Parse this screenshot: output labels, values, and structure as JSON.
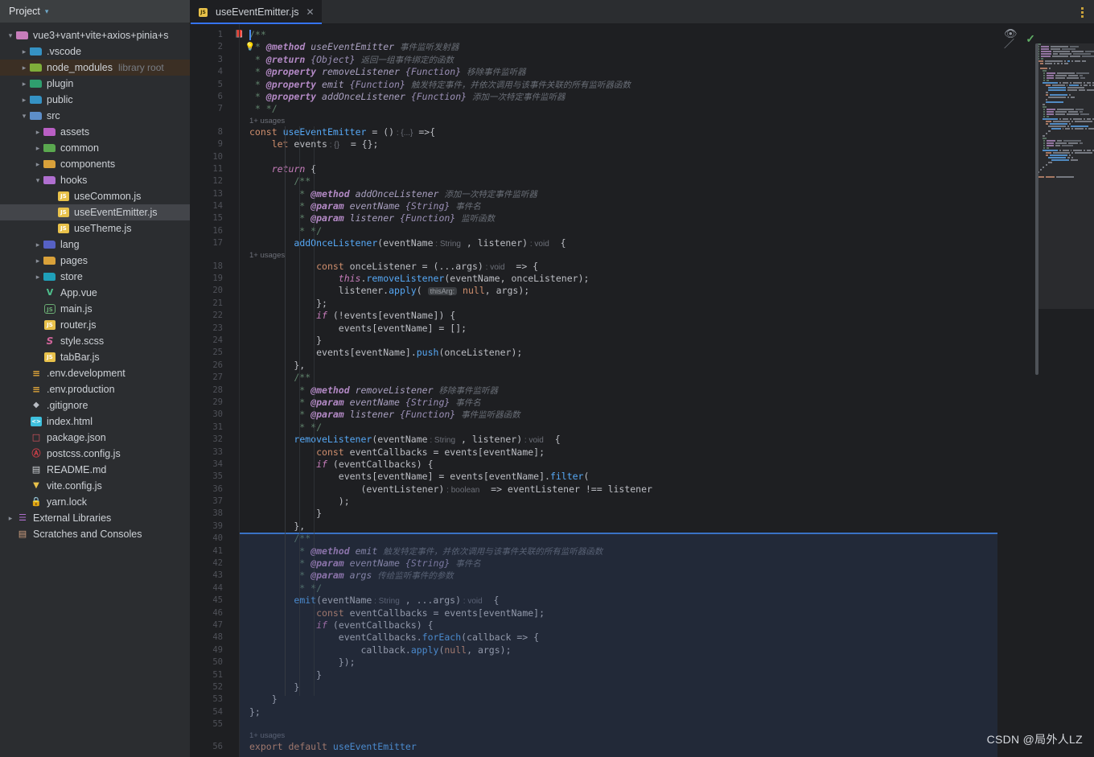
{
  "sidebar": {
    "title": "Project",
    "chevron_icon": "chevron-down-icon",
    "items": [
      {
        "label": "vue3+vant+vite+axios+pinia+s",
        "sub": "",
        "depth": 0,
        "state": "open",
        "icon": "folder-module-icon",
        "color": "#c77dbb",
        "glyph": "",
        "selected": ""
      },
      {
        "label": ".vscode",
        "sub": "",
        "depth": 1,
        "state": "closed",
        "icon": "folder-vscode-icon",
        "color": "#3592c4",
        "glyph": "",
        "selected": ""
      },
      {
        "label": "node_modules",
        "sub": "library root",
        "depth": 1,
        "state": "closed",
        "icon": "folder-node-icon",
        "color": "#7fae3a",
        "glyph": "",
        "selected": "lib"
      },
      {
        "label": "plugin",
        "sub": "",
        "depth": 1,
        "state": "closed",
        "icon": "folder-plugin-icon",
        "color": "#2f9e6e",
        "glyph": "",
        "selected": ""
      },
      {
        "label": "public",
        "sub": "",
        "depth": 1,
        "state": "closed",
        "icon": "folder-public-icon",
        "color": "#3592c4",
        "glyph": "",
        "selected": ""
      },
      {
        "label": "src",
        "sub": "",
        "depth": 1,
        "state": "open",
        "icon": "folder-source-icon",
        "color": "#5d8ec9",
        "glyph": "",
        "selected": ""
      },
      {
        "label": "assets",
        "sub": "",
        "depth": 2,
        "state": "closed",
        "icon": "folder-assets-icon",
        "color": "#b95fc4",
        "glyph": "",
        "selected": ""
      },
      {
        "label": "common",
        "sub": "",
        "depth": 2,
        "state": "closed",
        "icon": "folder-common-icon",
        "color": "#5aa84f",
        "glyph": "",
        "selected": ""
      },
      {
        "label": "components",
        "sub": "",
        "depth": 2,
        "state": "closed",
        "icon": "folder-components-icon",
        "color": "#d9a13a",
        "glyph": "",
        "selected": ""
      },
      {
        "label": "hooks",
        "sub": "",
        "depth": 2,
        "state": "open",
        "icon": "folder-hooks-icon",
        "color": "#b06fd0",
        "glyph": "",
        "selected": ""
      },
      {
        "label": "useCommon.js",
        "sub": "",
        "depth": 3,
        "state": "none",
        "icon": "js-file-icon",
        "color": "#e8c14a",
        "glyph": "JS",
        "selected": ""
      },
      {
        "label": "useEventEmitter.js",
        "sub": "",
        "depth": 3,
        "state": "none",
        "icon": "js-file-icon",
        "color": "#e8c14a",
        "glyph": "JS",
        "selected": "active"
      },
      {
        "label": "useTheme.js",
        "sub": "",
        "depth": 3,
        "state": "none",
        "icon": "js-file-icon",
        "color": "#e8c14a",
        "glyph": "JS",
        "selected": ""
      },
      {
        "label": "lang",
        "sub": "",
        "depth": 2,
        "state": "closed",
        "icon": "folder-lang-icon",
        "color": "#5661c4",
        "glyph": "",
        "selected": ""
      },
      {
        "label": "pages",
        "sub": "",
        "depth": 2,
        "state": "closed",
        "icon": "folder-pages-icon",
        "color": "#d9a13a",
        "glyph": "",
        "selected": ""
      },
      {
        "label": "store",
        "sub": "",
        "depth": 2,
        "state": "closed",
        "icon": "folder-store-icon",
        "color": "#1f9fb8",
        "glyph": "",
        "selected": ""
      },
      {
        "label": "App.vue",
        "sub": "",
        "depth": 2,
        "state": "none",
        "icon": "vue-file-icon",
        "color": "#4fc08d",
        "glyph": "V",
        "selected": ""
      },
      {
        "label": "main.js",
        "sub": "",
        "depth": 2,
        "state": "none",
        "icon": "node-js-file-icon",
        "color": "#6aab73",
        "glyph": "JS",
        "selected": ""
      },
      {
        "label": "router.js",
        "sub": "",
        "depth": 2,
        "state": "none",
        "icon": "js-file-icon",
        "color": "#e8c14a",
        "glyph": "JS",
        "selected": ""
      },
      {
        "label": "style.scss",
        "sub": "",
        "depth": 2,
        "state": "none",
        "icon": "scss-file-icon",
        "color": "#cf649a",
        "glyph": "S",
        "selected": ""
      },
      {
        "label": "tabBar.js",
        "sub": "",
        "depth": 2,
        "state": "none",
        "icon": "js-file-icon",
        "color": "#e8c14a",
        "glyph": "JS",
        "selected": ""
      },
      {
        "label": ".env.development",
        "sub": "",
        "depth": 1,
        "state": "none",
        "icon": "env-file-icon",
        "color": "#d9a13a",
        "glyph": "",
        "selected": ""
      },
      {
        "label": ".env.production",
        "sub": "",
        "depth": 1,
        "state": "none",
        "icon": "env-file-icon",
        "color": "#d9a13a",
        "glyph": "",
        "selected": ""
      },
      {
        "label": ".gitignore",
        "sub": "",
        "depth": 1,
        "state": "none",
        "icon": "git-file-icon",
        "color": "#b9bdc4",
        "glyph": "",
        "selected": ""
      },
      {
        "label": "index.html",
        "sub": "",
        "depth": 1,
        "state": "none",
        "icon": "html-file-icon",
        "color": "#3ec0dd",
        "glyph": "<>",
        "selected": ""
      },
      {
        "label": "package.json",
        "sub": "",
        "depth": 1,
        "state": "none",
        "icon": "package-json-icon",
        "color": "#e05561",
        "glyph": "",
        "selected": ""
      },
      {
        "label": "postcss.config.js",
        "sub": "",
        "depth": 1,
        "state": "none",
        "icon": "postcss-file-icon",
        "color": "#cc3f48",
        "glyph": "",
        "selected": ""
      },
      {
        "label": "README.md",
        "sub": "",
        "depth": 1,
        "state": "none",
        "icon": "markdown-file-icon",
        "color": "#cfd2d6",
        "glyph": "",
        "selected": ""
      },
      {
        "label": "vite.config.js",
        "sub": "",
        "depth": 1,
        "state": "none",
        "icon": "vite-file-icon",
        "color": "#e8c14a",
        "glyph": "",
        "selected": ""
      },
      {
        "label": "yarn.lock",
        "sub": "",
        "depth": 1,
        "state": "none",
        "icon": "lock-file-icon",
        "color": "#e05561",
        "glyph": "",
        "selected": ""
      },
      {
        "label": "External Libraries",
        "sub": "",
        "depth": 0,
        "state": "closed",
        "icon": "external-libraries-icon",
        "color": "#b06fd0",
        "glyph": "",
        "selected": ""
      },
      {
        "label": "Scratches and Consoles",
        "sub": "",
        "depth": 0,
        "state": "none",
        "icon": "scratches-icon",
        "color": "#d0a080",
        "glyph": "",
        "selected": ""
      }
    ]
  },
  "tabbar": {
    "tabs": [
      {
        "label": "useEventEmitter.js",
        "icon": "js-file-icon",
        "close_icon": "close-icon",
        "active": true
      }
    ],
    "overflow_icon": "more-options-icon"
  },
  "editor": {
    "inspection_eye_icon": "hide-inspections-icon",
    "inspection_status_icon": "no-problems-checkmark-icon",
    "bookmark_icon": "bookmark-icon",
    "intention_bulb_icon": "intention-bulb-icon",
    "first_line_number": 1,
    "last_line_number": 56,
    "selection_start_line": 40,
    "selection_end_line": 56,
    "usages_hint": "1+ usages",
    "inlay_this_arg": "thisArg:",
    "inlay_string": "String",
    "inlay_void": "void",
    "inlay_boolean": "boolean",
    "inlay_obj": "{...}",
    "inlay_brace": "{}",
    "lines": [
      {
        "n": 1,
        "text": "/**"
      },
      {
        "n": 2,
        "text": " * @method useEventEmitter 事件监听发射器"
      },
      {
        "n": 3,
        "text": " * @return {Object} 返回一组事件绑定的函数"
      },
      {
        "n": 4,
        "text": " * @property removeListener {Function} 移除事件监听器"
      },
      {
        "n": 5,
        "text": " * @property emit {Function} 触发特定事件，并依次调用与该事件关联的所有监听器函数"
      },
      {
        "n": 6,
        "text": " * @property addOnceListener {Function} 添加一次特定事件监听器"
      },
      {
        "n": 7,
        "text": " * */"
      },
      {
        "n": 8,
        "text": "const useEventEmitter = () : {...} =>{"
      },
      {
        "n": 9,
        "text": "    let events : {}  = {};"
      },
      {
        "n": 10,
        "text": ""
      },
      {
        "n": 11,
        "text": "    return {"
      },
      {
        "n": 12,
        "text": "        /**"
      },
      {
        "n": 13,
        "text": "         * @method addOnceListener 添加一次特定事件监听器"
      },
      {
        "n": 14,
        "text": "         * @param eventName {String} 事件名"
      },
      {
        "n": 15,
        "text": "         * @param listener {Function} 监听函数"
      },
      {
        "n": 16,
        "text": "         * */"
      },
      {
        "n": 17,
        "text": "        addOnceListener(eventName : String , listener) : void  {"
      },
      {
        "n": 18,
        "text": "            const onceListener = (...args) : void  => {"
      },
      {
        "n": 19,
        "text": "                this.removeListener(eventName, onceListener);"
      },
      {
        "n": 20,
        "text": "                listener.apply( thisArg: null, args);"
      },
      {
        "n": 21,
        "text": "            };"
      },
      {
        "n": 22,
        "text": "            if (!events[eventName]) {"
      },
      {
        "n": 23,
        "text": "                events[eventName] = [];"
      },
      {
        "n": 24,
        "text": "            }"
      },
      {
        "n": 25,
        "text": "            events[eventName].push(onceListener);"
      },
      {
        "n": 26,
        "text": "        },"
      },
      {
        "n": 27,
        "text": "        /**"
      },
      {
        "n": 28,
        "text": "         * @method removeListener 移除事件监听器"
      },
      {
        "n": 29,
        "text": "         * @param eventName {String} 事件名"
      },
      {
        "n": 30,
        "text": "         * @param listener {Function} 事件监听器函数"
      },
      {
        "n": 31,
        "text": "         * */"
      },
      {
        "n": 32,
        "text": "        removeListener(eventName : String , listener) : void  {"
      },
      {
        "n": 33,
        "text": "            const eventCallbacks = events[eventName];"
      },
      {
        "n": 34,
        "text": "            if (eventCallbacks) {"
      },
      {
        "n": 35,
        "text": "                events[eventName] = events[eventName].filter("
      },
      {
        "n": 36,
        "text": "                    (eventListener) : boolean  => eventListener !== listener"
      },
      {
        "n": 37,
        "text": "                );"
      },
      {
        "n": 38,
        "text": "            }"
      },
      {
        "n": 39,
        "text": "        },"
      },
      {
        "n": 40,
        "text": "        /**"
      },
      {
        "n": 41,
        "text": "         * @method emit 触发特定事件，并依次调用与该事件关联的所有监听器函数"
      },
      {
        "n": 42,
        "text": "         * @param eventName {String} 事件名"
      },
      {
        "n": 43,
        "text": "         * @param args 传给监听事件的参数"
      },
      {
        "n": 44,
        "text": "         * */"
      },
      {
        "n": 45,
        "text": "        emit(eventName : String , ...args) : void  {"
      },
      {
        "n": 46,
        "text": "            const eventCallbacks = events[eventName];"
      },
      {
        "n": 47,
        "text": "            if (eventCallbacks) {"
      },
      {
        "n": 48,
        "text": "                eventCallbacks.forEach(callback => {"
      },
      {
        "n": 49,
        "text": "                    callback.apply(null, args);"
      },
      {
        "n": 50,
        "text": "                });"
      },
      {
        "n": 51,
        "text": "            }"
      },
      {
        "n": 52,
        "text": "        }"
      },
      {
        "n": 53,
        "text": "    }"
      },
      {
        "n": 54,
        "text": "};"
      },
      {
        "n": 55,
        "text": ""
      },
      {
        "n": 56,
        "text": "export default useEventEmitter"
      }
    ]
  },
  "watermark": {
    "text": "CSDN @局外人LZ"
  },
  "colors": {
    "accent": "#3573f0",
    "editor_bg": "#1e1f22",
    "panel_bg": "#2b2d30",
    "selection": "#2e436e",
    "keyword": "#cf8e6d",
    "function": "#56a8f5",
    "string": "#6aab73",
    "comment": "#7a7e85",
    "jsdoc_tag": "#b389c5"
  }
}
